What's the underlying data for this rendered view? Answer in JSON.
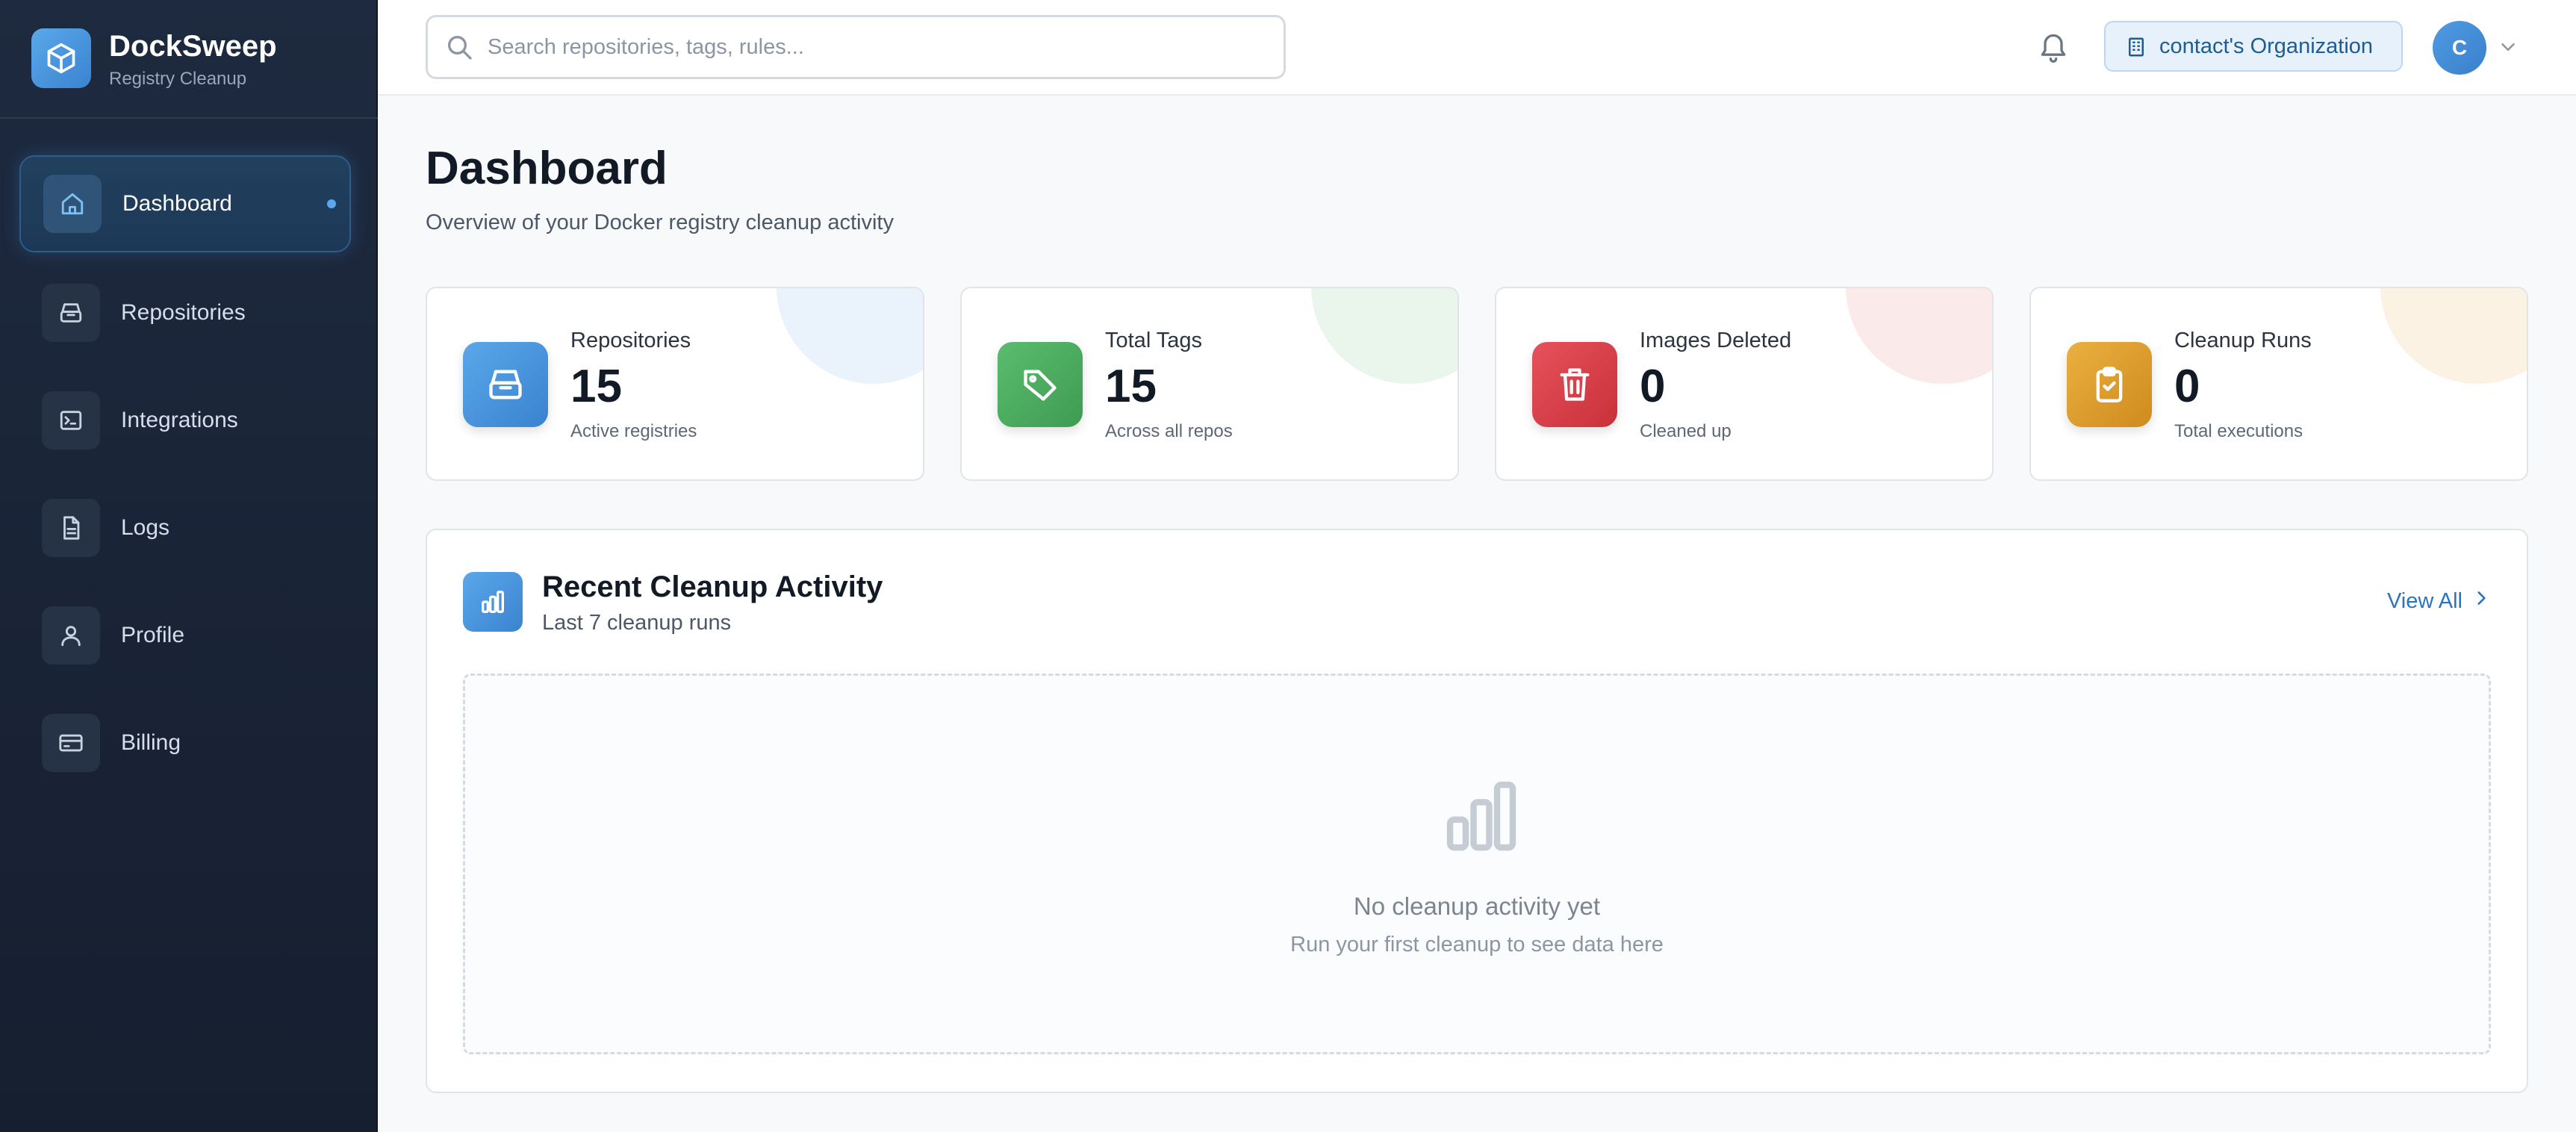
{
  "brand": {
    "name": "DockSweep",
    "subtitle": "Registry Cleanup"
  },
  "sidebar": {
    "items": [
      {
        "label": "Dashboard",
        "icon": "home-icon",
        "active": true
      },
      {
        "label": "Repositories",
        "icon": "archive-icon"
      },
      {
        "label": "Integrations",
        "icon": "terminal-icon"
      },
      {
        "label": "Logs",
        "icon": "file-text-icon"
      },
      {
        "label": "Profile",
        "icon": "user-icon"
      },
      {
        "label": "Billing",
        "icon": "credit-card-icon"
      }
    ]
  },
  "header": {
    "search_placeholder": "Search repositories, tags, rules...",
    "search_value": "",
    "org_label": "contact's Organization",
    "avatar_initial": "C"
  },
  "page": {
    "title": "Dashboard",
    "subtitle": "Overview of your Docker registry cleanup activity"
  },
  "stats": [
    {
      "label": "Repositories",
      "value": "15",
      "sub": "Active registries",
      "icon": "archive-icon",
      "color": "#3f8bd6"
    },
    {
      "label": "Total Tags",
      "value": "15",
      "sub": "Across all repos",
      "icon": "tag-icon",
      "color": "#43a35a"
    },
    {
      "label": "Images Deleted",
      "value": "0",
      "sub": "Cleaned up",
      "icon": "trash-icon",
      "color": "#d63a44"
    },
    {
      "label": "Cleanup Runs",
      "value": "0",
      "sub": "Total executions",
      "icon": "clipboard-check-icon",
      "color": "#dc9a24"
    }
  ],
  "activity": {
    "title": "Recent Cleanup Activity",
    "subtitle": "Last 7 cleanup runs",
    "view_all": "View All",
    "empty_title": "No cleanup activity yet",
    "empty_subtitle": "Run your first cleanup to see data here"
  },
  "colors": {
    "accent": "#3f8bd6",
    "sidebar_bg": "#1a2437",
    "link": "#2a74bf"
  }
}
